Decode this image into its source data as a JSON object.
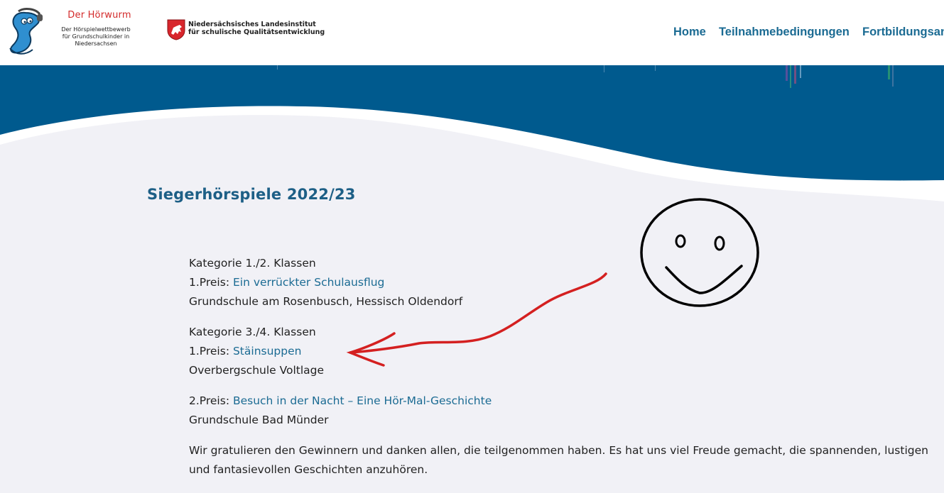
{
  "header": {
    "logo": {
      "title": "Der Hörwurm",
      "subtitle_line1": "Der Hörspielwettbewerb",
      "subtitle_line2": "für Grundschulkinder in Niedersachsen"
    },
    "partner": {
      "line1": "Niedersächsisches Landesinstitut",
      "line2": "für schulische Qualitätsentwicklung"
    },
    "nav": [
      {
        "label": "Home"
      },
      {
        "label": "Teilnahmebedingungen"
      },
      {
        "label": "Fortbildungsang"
      }
    ]
  },
  "main": {
    "heading": "Siegerhörspiele 2022/23",
    "categories": [
      {
        "title": "Kategorie 1./2. Klassen",
        "prize_prefix": "1.Preis: ",
        "prize_link": "Ein verrückter Schulausflug",
        "school": "Grundschule am Rosenbusch, Hessisch Oldendorf"
      },
      {
        "title": "Kategorie 3./4. Klassen",
        "prize_prefix": "1.Preis: ",
        "prize_link": "Stäinsuppen",
        "school": "Overbergschule Voltlage"
      }
    ],
    "second_prize": {
      "prize_prefix": "2.Preis: ",
      "prize_link": "Besuch in der Nacht – Eine Hör-Mal-Geschichte",
      "school": "Grundschule Bad Münder"
    },
    "closing_text": "Wir gratulieren den Gewinnern und danken allen, die teilgenommen haben. Es hat uns viel Freude gemacht, die spannenden, lustigen und fantasievollen Geschichten anzuhören."
  },
  "colors": {
    "brand_blue": "#005a8e",
    "link_blue": "#1b6b93",
    "heading_blue": "#1d5f86",
    "logo_red": "#d32a2a",
    "annotation_red": "#d42020"
  },
  "icons": {
    "logo": "hoerwurm-worm-logo",
    "partner": "niedersachsen-horse-shield",
    "annotations": [
      "smiley-face-drawing",
      "red-arrow-drawing"
    ]
  }
}
